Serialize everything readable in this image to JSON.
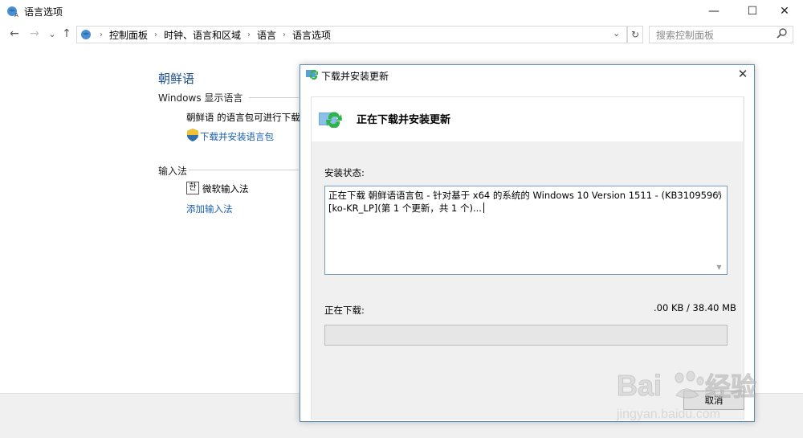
{
  "window": {
    "title": "语言选项",
    "minimize_glyph": "—",
    "maximize_glyph": "☐",
    "close_glyph": "✕"
  },
  "nav": {
    "back_glyph": "←",
    "forward_glyph": "→",
    "recent_glyph": "⌄",
    "up_glyph": "↑",
    "breadcrumbs": [
      "控制面板",
      "时钟、语言和区域",
      "语言",
      "语言选项"
    ],
    "dropdown_glyph": "⌄",
    "refresh_glyph": "↻",
    "search_placeholder": "搜索控制面板"
  },
  "main": {
    "language_name": "朝鲜语",
    "display_language_heading": "Windows 显示语言",
    "pack_status": "朝鲜语 的语言包可进行下载",
    "download_link": "下载并安装语言包",
    "input_method_heading": "输入法",
    "ime_icon_glyph": "한",
    "ime_name": "微软输入法",
    "add_ime_link": "添加输入法"
  },
  "dialog": {
    "title": "下载并安装更新",
    "heading": "正在下载并安装更新",
    "status_label": "安装状态:",
    "status_text_line1": "正在下载 朝鲜语语言包 - 针对基于 x64 的系统的 Windows 10 Version 1511 - (KB3109596)",
    "status_text_line2": "[ko-KR_LP](第 1 个更新，共 1 个)...",
    "downloading_label": "正在下载:",
    "downloaded_size": ".00 KB / 38.40 MB",
    "progress_fraction": 0,
    "cancel_label": "取消",
    "close_glyph": "✕"
  },
  "watermark": {
    "brand": "Bai",
    "brand_suffix": "经验",
    "url": "jingyan.baidu.com"
  },
  "colors": {
    "link": "#1a5fb4",
    "title_blue": "#1e4e8c",
    "dialog_border": "#5b8db8",
    "progress_green": "#06b025"
  }
}
